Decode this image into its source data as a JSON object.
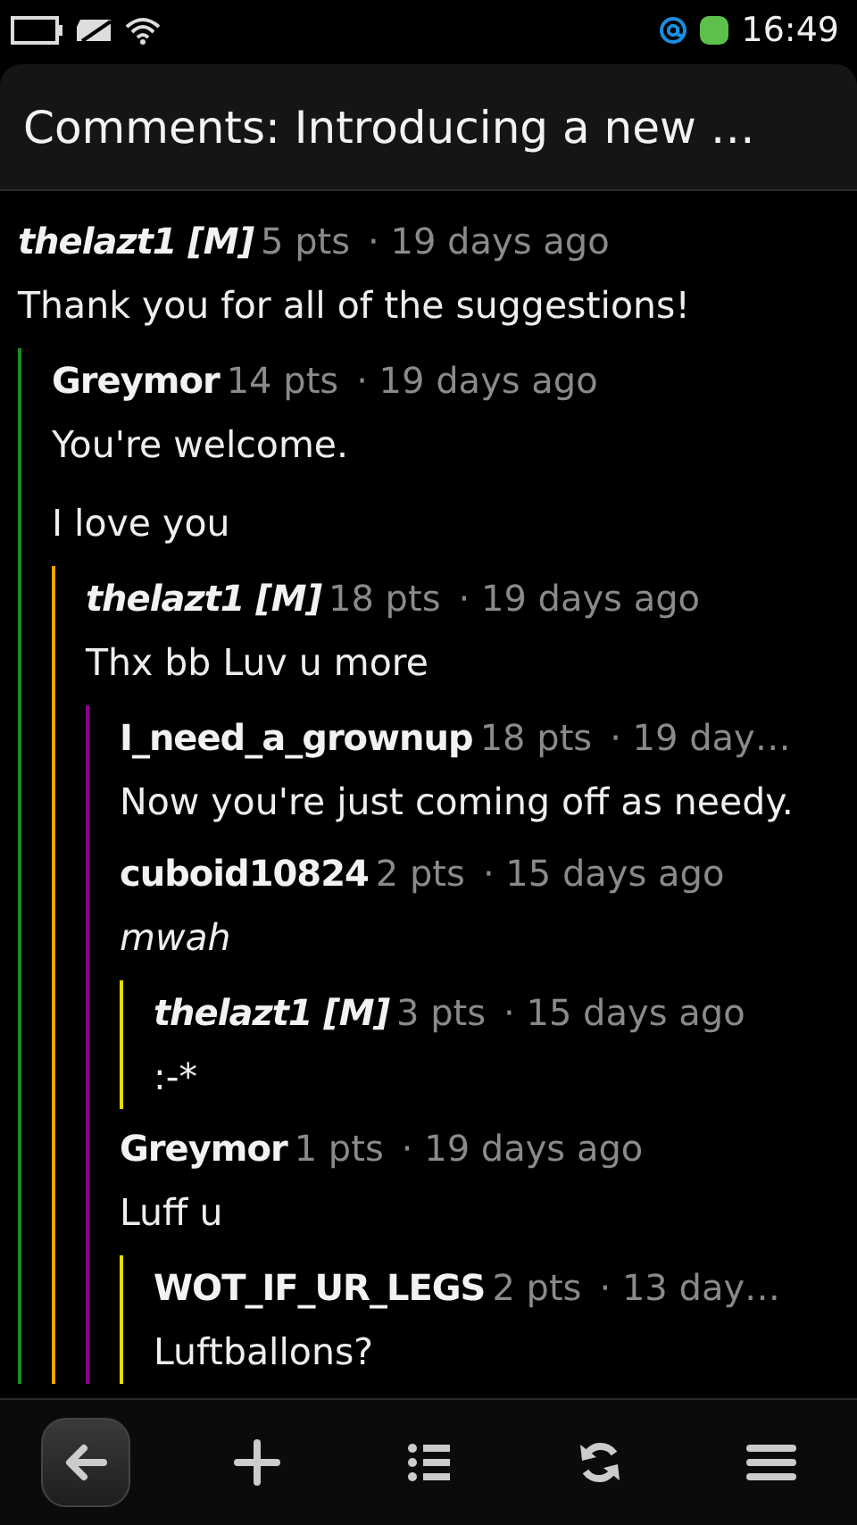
{
  "status_bar": {
    "time": "16:49"
  },
  "header": {
    "title": "Comments: Introducing a new …"
  },
  "comments": [
    {
      "author": "thelazt1 [M]",
      "submitter": true,
      "points": "5 pts",
      "time": "· 19 days ago",
      "body": [
        "Thank you for all of the suggestions!"
      ],
      "italic": false,
      "color": "#1e8c1e",
      "children": [
        {
          "author": "Greymor",
          "submitter": false,
          "points": "14 pts",
          "time": "· 19 days ago",
          "body": [
            "You're welcome.",
            "I love you"
          ],
          "italic": false,
          "color": "#f5a300",
          "children": [
            {
              "author": "thelazt1 [M]",
              "submitter": true,
              "points": "18 pts",
              "time": "· 19 days ago",
              "body": [
                "Thx bb Luv u more"
              ],
              "italic": false,
              "color": "#8c008c",
              "children": [
                {
                  "author": "I_need_a_grownup",
                  "submitter": false,
                  "points": "18 pts",
                  "time": "· 19 day…",
                  "body": [
                    "Now you're just coming off as needy."
                  ],
                  "italic": false
                },
                {
                  "author": "cuboid10824",
                  "submitter": false,
                  "points": "2 pts",
                  "time": "· 15 days ago",
                  "body": [
                    "mwah"
                  ],
                  "italic": true,
                  "color": "#e6dc00",
                  "children": [
                    {
                      "author": "thelazt1 [M]",
                      "submitter": true,
                      "points": "3 pts",
                      "time": "· 15 days ago",
                      "body": [
                        ":-*"
                      ],
                      "italic": false
                    }
                  ]
                },
                {
                  "author": "Greymor",
                  "submitter": false,
                  "points": "1 pts",
                  "time": "· 19 days ago",
                  "body": [
                    "Luff u"
                  ],
                  "italic": false,
                  "color": "#e6dc00",
                  "children": [
                    {
                      "author": "WOT_IF_UR_LEGS",
                      "submitter": false,
                      "points": "2 pts",
                      "time": "· 13 day…",
                      "body": [
                        "Luftballons?"
                      ],
                      "italic": false
                    }
                  ]
                }
              ]
            }
          ]
        }
      ]
    }
  ],
  "toolbar": [
    {
      "kind": "back"
    },
    {
      "kind": "add"
    },
    {
      "kind": "list"
    },
    {
      "kind": "refresh"
    },
    {
      "kind": "menu"
    }
  ]
}
